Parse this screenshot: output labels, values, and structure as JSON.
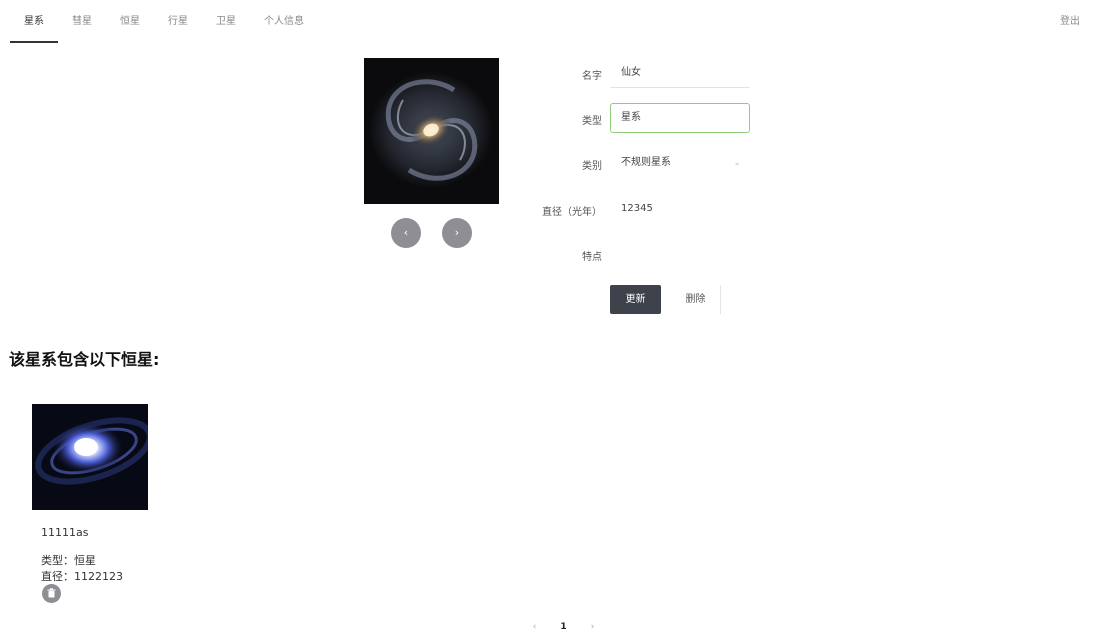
{
  "nav": {
    "tabs": [
      {
        "label": "星系",
        "active": true
      },
      {
        "label": "彗星",
        "active": false
      },
      {
        "label": "恒星",
        "active": false
      },
      {
        "label": "行星",
        "active": false
      },
      {
        "label": "卫星",
        "active": false
      },
      {
        "label": "个人信息",
        "active": false
      }
    ],
    "logout": "登出"
  },
  "gallery": {
    "prev_icon": "‹",
    "next_icon": "›"
  },
  "form": {
    "name_label": "名字",
    "name_value": "仙女",
    "type_label": "类型",
    "type_value": "星系",
    "category_label": "类别",
    "category_value": "不规则星系",
    "diameter_label": "直径（光年）",
    "diameter_value": "12345",
    "feature_label": "特点",
    "feature_value": "",
    "update_button": "更新",
    "delete_button": "删除"
  },
  "section": {
    "title": "该星系包含以下恒星:"
  },
  "stars": [
    {
      "name": "11111as",
      "type_line": "类型：恒星",
      "diameter_line": "直径：1122123"
    }
  ],
  "pagination": {
    "prev": "‹",
    "current": "1",
    "next": "›"
  },
  "colors": {
    "accent_dark": "#3d424b",
    "focus_green": "#8fce7d",
    "nav_active": "#333333"
  }
}
